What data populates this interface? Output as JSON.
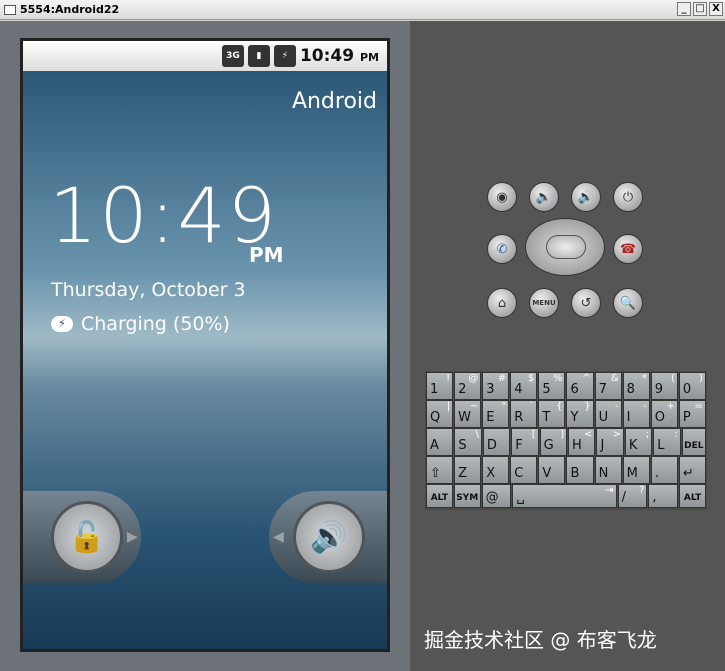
{
  "window": {
    "title": "5554:Android22",
    "minimize": "_",
    "maximize": "□",
    "close": "X"
  },
  "status": {
    "network": "3G",
    "signal": "signal",
    "battery": "⚡",
    "time": "10:49",
    "ampm": "PM"
  },
  "lock": {
    "carrier": "Android",
    "time": "10:49",
    "ampm": "PM",
    "date": "Thursday, October 3",
    "charging": "Charging (50%)",
    "unlock_icon": "🔓",
    "sound_icon": "🔊"
  },
  "controls": {
    "camera": "◉",
    "vol_down": "🔈",
    "vol_up": "🔊",
    "power": "⏻",
    "call": "✆",
    "end": "☎",
    "home": "⌂",
    "menu": "MENU",
    "back": "↺",
    "search": "🔍"
  },
  "keyboard": {
    "rows": [
      [
        {
          "k": "1",
          "a": "!"
        },
        {
          "k": "2",
          "a": "@"
        },
        {
          "k": "3",
          "a": "#"
        },
        {
          "k": "4",
          "a": "$"
        },
        {
          "k": "5",
          "a": "%"
        },
        {
          "k": "6",
          "a": "^"
        },
        {
          "k": "7",
          "a": "&"
        },
        {
          "k": "8",
          "a": "*"
        },
        {
          "k": "9",
          "a": "("
        },
        {
          "k": "0",
          "a": ")"
        }
      ],
      [
        {
          "k": "Q",
          "a": "|"
        },
        {
          "k": "W",
          "a": "~"
        },
        {
          "k": "E",
          "a": "\""
        },
        {
          "k": "R",
          "a": "`"
        },
        {
          "k": "T",
          "a": "{"
        },
        {
          "k": "Y",
          "a": "}"
        },
        {
          "k": "U",
          "a": "-"
        },
        {
          "k": "I",
          "a": "-"
        },
        {
          "k": "O",
          "a": "+"
        },
        {
          "k": "P",
          "a": "="
        }
      ],
      [
        {
          "k": "A",
          "a": ""
        },
        {
          "k": "S",
          "a": "\\"
        },
        {
          "k": "D",
          "a": ""
        },
        {
          "k": "F",
          "a": "["
        },
        {
          "k": "G",
          "a": "]"
        },
        {
          "k": "H",
          "a": "<"
        },
        {
          "k": "J",
          "a": ">"
        },
        {
          "k": "K",
          "a": ";"
        },
        {
          "k": "L",
          "a": ":"
        },
        {
          "k": "DEL",
          "a": ""
        }
      ],
      [
        {
          "k": "⇧",
          "a": ""
        },
        {
          "k": "Z",
          "a": ""
        },
        {
          "k": "X",
          "a": ""
        },
        {
          "k": "C",
          "a": ""
        },
        {
          "k": "V",
          "a": ""
        },
        {
          "k": "B",
          "a": ""
        },
        {
          "k": "N",
          "a": ""
        },
        {
          "k": "M",
          "a": ""
        },
        {
          "k": ".",
          "a": ""
        },
        {
          "k": "↵",
          "a": ""
        }
      ],
      [
        {
          "k": "ALT",
          "a": ""
        },
        {
          "k": "SYM",
          "a": ""
        },
        {
          "k": "@",
          "a": ""
        },
        {
          "k": "␣",
          "a": "⇥"
        },
        {
          "k": "/",
          "a": "?"
        },
        {
          "k": ",",
          "a": ""
        },
        {
          "k": "ALT",
          "a": ""
        }
      ]
    ]
  },
  "watermark": "掘金技术社区 @ 布客飞龙"
}
